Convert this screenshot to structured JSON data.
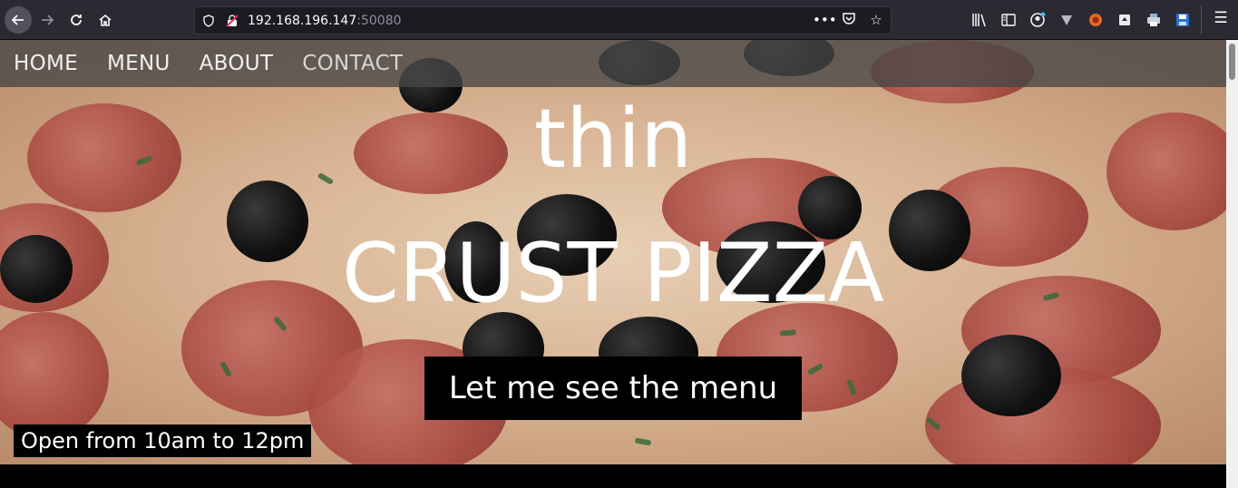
{
  "browser": {
    "url_host": "192.168.196.147",
    "url_port": ":50080",
    "icons": [
      "back-icon",
      "forward-icon",
      "reload-icon",
      "home-icon",
      "shield-icon",
      "insecure-lock-icon",
      "more-icon",
      "pocket-icon",
      "bookmark-star-icon",
      "library-icon",
      "sidebar-icon",
      "account-icon",
      "extension-v-icon",
      "extension-fox-icon",
      "extension-container-icon",
      "extension-print-icon",
      "extension-save-icon",
      "hamburger-menu-icon"
    ]
  },
  "site": {
    "nav": {
      "items": [
        {
          "label": "HOME"
        },
        {
          "label": "MENU"
        },
        {
          "label": "ABOUT"
        },
        {
          "label": "CONTACT"
        }
      ]
    },
    "hero": {
      "line1": "thin",
      "line2": "CRUST PIZZA",
      "cta_label": "Let me see the menu",
      "hours": "Open from 10am to 12pm"
    }
  },
  "colors": {
    "nav_bg": "#464646",
    "button_bg": "#000000",
    "text": "#ffffff"
  }
}
